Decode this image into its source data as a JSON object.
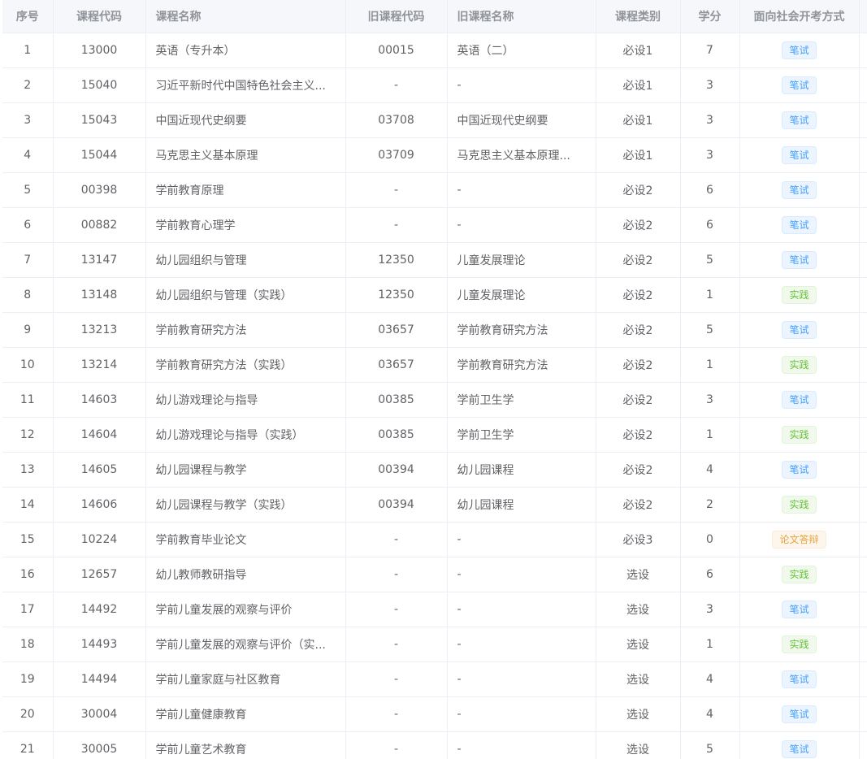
{
  "table": {
    "headers": [
      "序号",
      "课程代码",
      "课程名称",
      "旧课程代码",
      "旧课程名称",
      "课程类别",
      "学分",
      "面向社会开考方式"
    ],
    "tag_colors": {
      "笔试": "#409eff",
      "实践": "#67c23a",
      "论文答辩": "#e6a23c"
    },
    "rows": [
      {
        "idx": "1",
        "code": "13000",
        "name": "英语（专升本）",
        "old_code": "00015",
        "old_name": "英语（二）",
        "type": "必设1",
        "credit": "7",
        "mode": "笔试",
        "tone": "blue"
      },
      {
        "idx": "2",
        "code": "15040",
        "name": "习近平新时代中国特色社会主义...",
        "old_code": "-",
        "old_name": "-",
        "type": "必设1",
        "credit": "3",
        "mode": "笔试",
        "tone": "blue"
      },
      {
        "idx": "3",
        "code": "15043",
        "name": "中国近现代史纲要",
        "old_code": "03708",
        "old_name": "中国近现代史纲要",
        "type": "必设1",
        "credit": "3",
        "mode": "笔试",
        "tone": "blue"
      },
      {
        "idx": "4",
        "code": "15044",
        "name": "马克思主义基本原理",
        "old_code": "03709",
        "old_name": "马克思主义基本原理...",
        "type": "必设1",
        "credit": "3",
        "mode": "笔试",
        "tone": "blue"
      },
      {
        "idx": "5",
        "code": "00398",
        "name": "学前教育原理",
        "old_code": "-",
        "old_name": "-",
        "type": "必设2",
        "credit": "6",
        "mode": "笔试",
        "tone": "blue"
      },
      {
        "idx": "6",
        "code": "00882",
        "name": "学前教育心理学",
        "old_code": "-",
        "old_name": "-",
        "type": "必设2",
        "credit": "6",
        "mode": "笔试",
        "tone": "blue"
      },
      {
        "idx": "7",
        "code": "13147",
        "name": "幼儿园组织与管理",
        "old_code": "12350",
        "old_name": "儿童发展理论",
        "type": "必设2",
        "credit": "5",
        "mode": "笔试",
        "tone": "blue"
      },
      {
        "idx": "8",
        "code": "13148",
        "name": "幼儿园组织与管理（实践）",
        "old_code": "12350",
        "old_name": "儿童发展理论",
        "type": "必设2",
        "credit": "1",
        "mode": "实践",
        "tone": "green"
      },
      {
        "idx": "9",
        "code": "13213",
        "name": "学前教育研究方法",
        "old_code": "03657",
        "old_name": "学前教育研究方法",
        "type": "必设2",
        "credit": "5",
        "mode": "笔试",
        "tone": "blue"
      },
      {
        "idx": "10",
        "code": "13214",
        "name": "学前教育研究方法（实践）",
        "old_code": "03657",
        "old_name": "学前教育研究方法",
        "type": "必设2",
        "credit": "1",
        "mode": "实践",
        "tone": "green"
      },
      {
        "idx": "11",
        "code": "14603",
        "name": "幼儿游戏理论与指导",
        "old_code": "00385",
        "old_name": "学前卫生学",
        "type": "必设2",
        "credit": "3",
        "mode": "笔试",
        "tone": "blue"
      },
      {
        "idx": "12",
        "code": "14604",
        "name": "幼儿游戏理论与指导（实践）",
        "old_code": "00385",
        "old_name": "学前卫生学",
        "type": "必设2",
        "credit": "1",
        "mode": "实践",
        "tone": "green"
      },
      {
        "idx": "13",
        "code": "14605",
        "name": "幼儿园课程与教学",
        "old_code": "00394",
        "old_name": "幼儿园课程",
        "type": "必设2",
        "credit": "4",
        "mode": "笔试",
        "tone": "blue"
      },
      {
        "idx": "14",
        "code": "14606",
        "name": "幼儿园课程与教学（实践）",
        "old_code": "00394",
        "old_name": "幼儿园课程",
        "type": "必设2",
        "credit": "2",
        "mode": "实践",
        "tone": "green"
      },
      {
        "idx": "15",
        "code": "10224",
        "name": "学前教育毕业论文",
        "old_code": "-",
        "old_name": "-",
        "type": "必设3",
        "credit": "0",
        "mode": "论文答辩",
        "tone": "orange"
      },
      {
        "idx": "16",
        "code": "12657",
        "name": "幼儿教师教研指导",
        "old_code": "-",
        "old_name": "-",
        "type": "选设",
        "credit": "6",
        "mode": "实践",
        "tone": "green"
      },
      {
        "idx": "17",
        "code": "14492",
        "name": "学前儿童发展的观察与评价",
        "old_code": "-",
        "old_name": "-",
        "type": "选设",
        "credit": "3",
        "mode": "笔试",
        "tone": "blue"
      },
      {
        "idx": "18",
        "code": "14493",
        "name": "学前儿童发展的观察与评价（实...",
        "old_code": "-",
        "old_name": "-",
        "type": "选设",
        "credit": "1",
        "mode": "实践",
        "tone": "green"
      },
      {
        "idx": "19",
        "code": "14494",
        "name": "学前儿童家庭与社区教育",
        "old_code": "-",
        "old_name": "-",
        "type": "选设",
        "credit": "4",
        "mode": "笔试",
        "tone": "blue"
      },
      {
        "idx": "20",
        "code": "30004",
        "name": "学前儿童健康教育",
        "old_code": "-",
        "old_name": "-",
        "type": "选设",
        "credit": "4",
        "mode": "笔试",
        "tone": "blue"
      },
      {
        "idx": "21",
        "code": "30005",
        "name": "学前儿童艺术教育",
        "old_code": "-",
        "old_name": "-",
        "type": "选设",
        "credit": "5",
        "mode": "笔试",
        "tone": "blue"
      }
    ]
  }
}
